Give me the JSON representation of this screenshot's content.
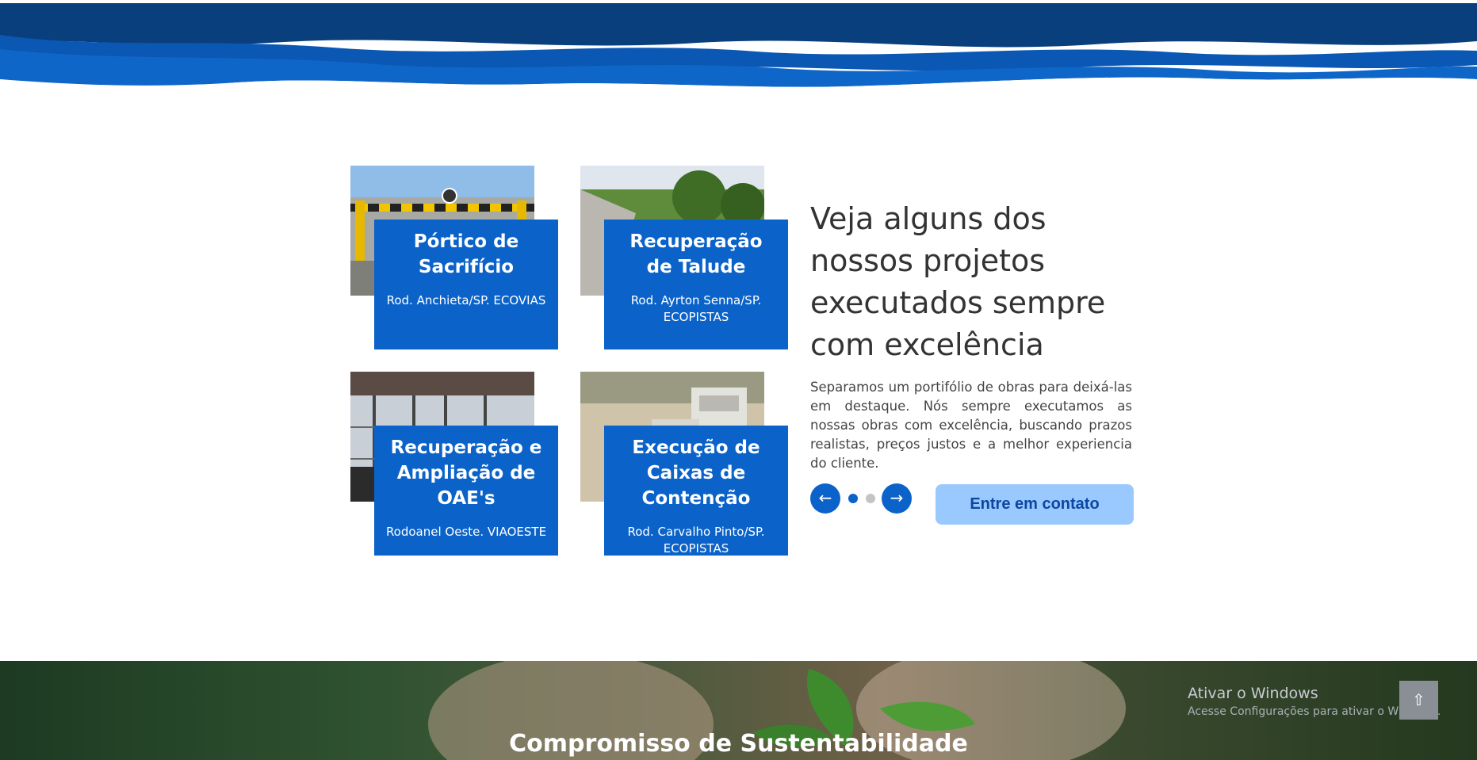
{
  "projects": [
    {
      "title": "Pórtico de Sacrifício",
      "location": "Rod. Anchieta/SP. ECOVIAS"
    },
    {
      "title": "Recuperação de Talude",
      "location": "Rod. Ayrton Senna/SP. ECOPISTAS"
    },
    {
      "title": "Recuperação e Ampliação de OAE's",
      "location": "Rodoanel Oeste. VIAOESTE"
    },
    {
      "title": "Execução de Caixas de Contenção",
      "location": "Rod. Carvalho Pinto/SP. ECOPISTAS"
    }
  ],
  "intro": {
    "heading": "Veja alguns dos nossos projetos executados sempre com excelência",
    "text": "Separamos um portifólio de obras para deixá-las em destaque. Nós sempre executamos as nossas obras com excelência, buscando prazos realistas, preços justos e a melhor experiencia do cliente.",
    "cta": "Entre em contato"
  },
  "carousel": {
    "prev": "←",
    "next": "→",
    "active_dot": 1,
    "dot_count": 2
  },
  "footer": {
    "title": "Compromisso de Sustentabilidade"
  },
  "windows_watermark": {
    "line1": "Ativar o Windows",
    "line2": "Acesse Configurações para ativar o Windows."
  },
  "scroll_top": "⇧",
  "colors": {
    "brand_blue": "#0b63c9",
    "cta_bg": "#99c9ff",
    "cta_text": "#0d47a1"
  }
}
